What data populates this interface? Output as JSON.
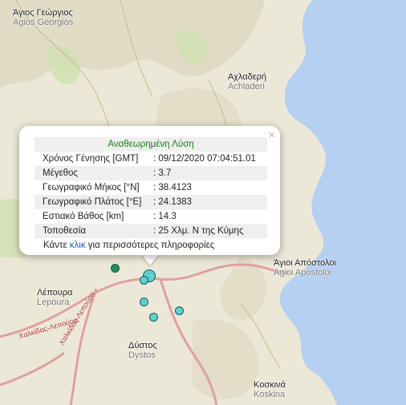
{
  "places": [
    {
      "greek": "Άγιος Γεώργιος",
      "latin": "Agios Georgios"
    },
    {
      "greek": "Αχλαδερή",
      "latin": "Achladeri"
    },
    {
      "greek": "Άγιοι Απόστολοι",
      "latin": "Agioi Apostoloi"
    },
    {
      "greek": "Λέπουρα",
      "latin": "Lepoura"
    },
    {
      "greek": "Δύστος",
      "latin": "Dystos"
    },
    {
      "greek": "Κοσκινά",
      "latin": "Koskina"
    }
  ],
  "road_labels": [
    "Χαλκίδας-Λεπούρα",
    "Χαλκίδας-Λεπούρα"
  ],
  "colors": {
    "sea": "#b5d0f0",
    "land": "#ece8d8",
    "road": "#e0a0a0",
    "quake": "#5fd0d0",
    "title_green": "#1b7a1b",
    "link_blue": "#1a5fb4"
  },
  "popup": {
    "close_label": "×",
    "title": "Αναθεωρημένη Λύση",
    "rows": [
      {
        "label": "Χρόνος Γένησης [GMT]",
        "value": ": 09/12/2020 07:04:51.01"
      },
      {
        "label": "Μέγεθος",
        "value": ": 3.7"
      },
      {
        "label": "Γεωγραφικό Μήκος [°N]",
        "value": ": 38.4123"
      },
      {
        "label": "Γεωγραφικό Πλάτος [°E]",
        "value": ": 24.1383"
      },
      {
        "label": "Εστιακό Βάθος [km]",
        "value": ": 14.3"
      },
      {
        "label": "Τοποθεσία",
        "value": ": 25 Χλμ. Ν της Κύμης"
      }
    ],
    "more_prefix": "Κάντε ",
    "more_link": "κλικ",
    "more_suffix": " για περισσότερες πληροφορίες"
  }
}
